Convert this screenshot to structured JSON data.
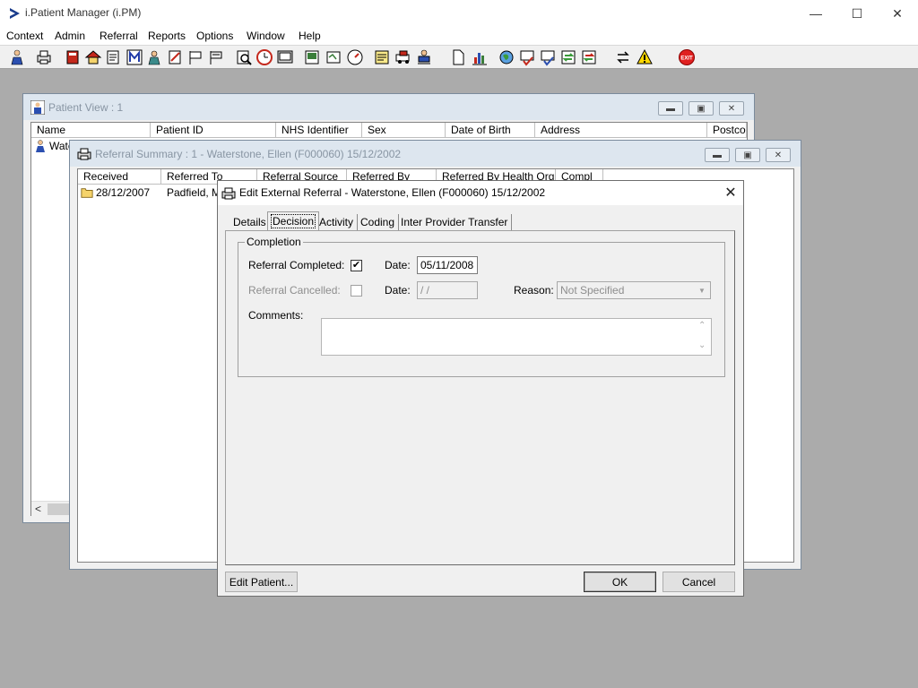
{
  "app": {
    "title": "i.Patient Manager (i.PM)"
  },
  "menu": [
    "Context",
    "Admin",
    "Referral",
    "Reports",
    "Options",
    "Window",
    "Help"
  ],
  "toolbar": {
    "icons": [
      "patient-icon",
      "print-icon",
      "book-icon",
      "house-icon",
      "report-icon",
      "m-icon",
      "doctor-icon",
      "edit-icon",
      "flag-icon",
      "flag2-icon",
      "search-icon",
      "clock-icon",
      "screen-icon",
      "photo-icon",
      "document-icon",
      "gauge-icon",
      "note-icon",
      "ambulance-icon",
      "transport-icon",
      "page-icon",
      "chart-icon",
      "globe-icon",
      "checklist-icon",
      "checklist2-icon",
      "sync-icon",
      "sync2-icon",
      "switch-icon",
      "warning-icon",
      "exit-icon"
    ],
    "exit_label": "EXIT"
  },
  "patient_view": {
    "title": "Patient View : 1",
    "columns": [
      "Name",
      "Patient ID",
      "NHS Identifier",
      "Sex",
      "Date of Birth",
      "Address",
      "Postcod"
    ],
    "row_name": "Wate"
  },
  "referral_summary": {
    "title": "Referral Summary : 1 - Waterstone, Ellen (F000060) 15/12/2002",
    "columns": [
      "Received",
      "Referred To",
      "Referral Source",
      "Referred By",
      "Referred By Health Org",
      "Compl"
    ],
    "row": {
      "received": "28/12/2007",
      "referred_to": "Padfield, Mr"
    }
  },
  "dialog": {
    "title": "Edit External Referral - Waterstone, Ellen (F000060) 15/12/2002",
    "tabs": [
      "Details",
      "Decision",
      "Activity",
      "Coding",
      "Inter Provider Transfer"
    ],
    "active_tab": "Decision",
    "group_label": "Completion",
    "referral_completed_label": "Referral Completed:",
    "referral_completed_checked": true,
    "completed_date_label": "Date:",
    "completed_date": "05/11/2008",
    "referral_cancelled_label": "Referral Cancelled:",
    "referral_cancelled_checked": false,
    "cancelled_date_label": "Date:",
    "cancelled_date": " /  /",
    "reason_label": "Reason:",
    "reason_value": "Not Specified",
    "comments_label": "Comments:",
    "comments_value": "",
    "edit_patient_button": "Edit Patient...",
    "ok_button": "OK",
    "cancel_button": "Cancel"
  }
}
